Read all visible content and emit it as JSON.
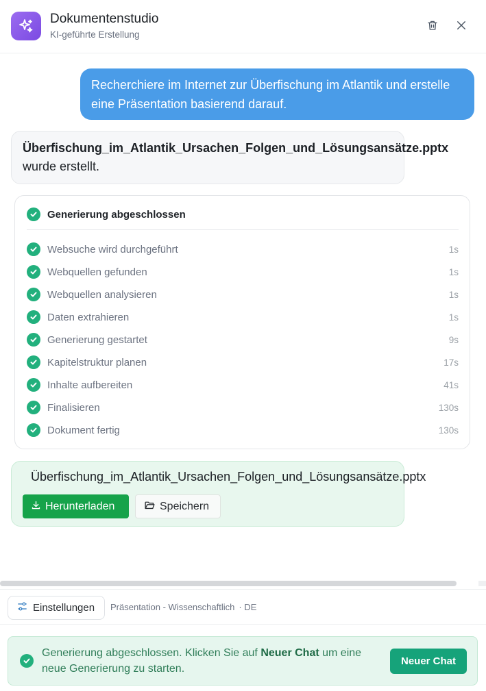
{
  "header": {
    "title": "Dokumentenstudio",
    "subtitle": "KI-geführte Erstellung",
    "icon": "sparkles-icon",
    "accent": "#8a5cf0"
  },
  "chat": {
    "user_message": "Recherchiere im Internet zur Überfischung im Atlantik und erstelle eine Präsentation basierend darauf.",
    "bot_message": {
      "filename": "Überfischung_im_Atlantik_Ursachen_Folgen_und_Lösungsansätze.pptx",
      "suffix": "wurde erstellt."
    },
    "steps": {
      "title": "Generierung abgeschlossen",
      "items": [
        {
          "label": "Websuche wird durchgeführt",
          "time": "1s"
        },
        {
          "label": "Webquellen gefunden",
          "time": "1s"
        },
        {
          "label": "Webquellen analysieren",
          "time": "1s"
        },
        {
          "label": "Daten extrahieren",
          "time": "1s"
        },
        {
          "label": "Generierung gestartet",
          "time": "9s"
        },
        {
          "label": "Kapitelstruktur planen",
          "time": "17s"
        },
        {
          "label": "Inhalte aufbereiten",
          "time": "41s"
        },
        {
          "label": "Finalisieren",
          "time": "130s"
        },
        {
          "label": "Dokument fertig",
          "time": "130s"
        }
      ]
    },
    "file_card": {
      "filename": "Überfischung_im_Atlantik_Ursachen_Folgen_und_Lösungsansätze.pptx",
      "download_label": "Herunterladen",
      "save_label": "Speichern"
    }
  },
  "settings": {
    "button_label": "Einstellungen",
    "info": "Präsentation - Wissenschaftlich",
    "lang": "· DE"
  },
  "banner": {
    "text_before": "Generierung abgeschlossen. Klicken Sie auf ",
    "text_bold": "Neuer Chat",
    "text_after": " um eine neue Generierung zu starten.",
    "button_label": "Neuer Chat"
  },
  "colors": {
    "user_bubble": "#4a9ce8",
    "success": "#22b07d",
    "download": "#16a34a"
  }
}
